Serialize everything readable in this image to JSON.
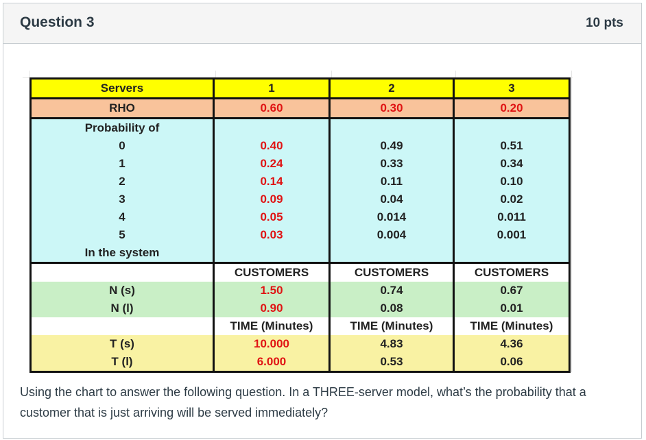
{
  "question": {
    "title": "Question 3",
    "points": "10 pts",
    "text": "Using the chart to answer the following question.  In a THREE-server model, what’s the probability that a customer that is just arriving will be served immediately?"
  },
  "table": {
    "servers_label": "Servers",
    "servers": [
      "1",
      "2",
      "3"
    ],
    "rho_label": "RHO",
    "rho": [
      "0.60",
      "0.30",
      "0.20"
    ],
    "prob_label": "Probability of",
    "prob_rows": [
      {
        "n": "0",
        "values": [
          "0.40",
          "0.49",
          "0.51"
        ]
      },
      {
        "n": "1",
        "values": [
          "0.24",
          "0.33",
          "0.34"
        ]
      },
      {
        "n": "2",
        "values": [
          "0.14",
          "0.11",
          "0.10"
        ]
      },
      {
        "n": "3",
        "values": [
          "0.09",
          "0.04",
          "0.02"
        ]
      },
      {
        "n": "4",
        "values": [
          "0.05",
          "0.014",
          "0.011"
        ]
      },
      {
        "n": "5",
        "values": [
          "0.03",
          "0.004",
          "0.001"
        ]
      }
    ],
    "in_system_label": "In the system",
    "customers_header": [
      "CUSTOMERS",
      "CUSTOMERS",
      "CUSTOMERS"
    ],
    "ns_label": "N (s)",
    "ns": [
      "1.50",
      "0.74",
      "0.67"
    ],
    "nl_label": "N (l)",
    "nl": [
      "0.90",
      "0.08",
      "0.01"
    ],
    "time_header": [
      "TIME (Minutes)",
      "TIME (Minutes)",
      "TIME (Minutes)"
    ],
    "ts_label": "T (s)",
    "ts": [
      "10.000",
      "4.83",
      "4.36"
    ],
    "tl_label": "T (l)",
    "tl": [
      "6.000",
      "0.53",
      "0.06"
    ],
    "highlight_color": "#e01414"
  }
}
